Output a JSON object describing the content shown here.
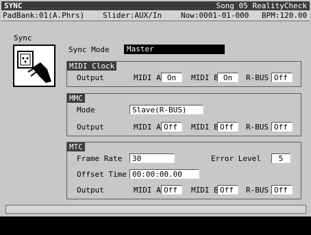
{
  "title": "SYNC",
  "song": "Song 05 RealityCheck",
  "info": {
    "padbank": "PadBank:01(A.Phrs)",
    "slider": "Slider:AUX/In",
    "now": "Now:0001-01-000",
    "bpm": "BPM:120.00"
  },
  "sidebar_label": "Sync",
  "sync_mode": {
    "label": "Sync Mode",
    "value": "Master"
  },
  "midi_clock": {
    "title": "MIDI Clock",
    "output_label": "Output",
    "midi_a_label": "MIDI A",
    "midi_a": "On",
    "midi_b_label": "MIDI B",
    "midi_b": "On",
    "rbus_label": "R-BUS",
    "rbus": "Off"
  },
  "mmc": {
    "title": "MMC",
    "mode_label": "Mode",
    "mode_value": "Slave(R-BUS)",
    "output_label": "Output",
    "midi_a_label": "MIDI A",
    "midi_a": "Off",
    "midi_b_label": "MIDI B",
    "midi_b": "Off",
    "rbus_label": "R-BUS",
    "rbus": "Off"
  },
  "mtc": {
    "title": "MTC",
    "frame_rate_label": "Frame Rate",
    "frame_rate": "30",
    "error_level_label": "Error Level",
    "error_level": "5",
    "offset_label": "Offset Time",
    "offset_value": "00:00:00.00",
    "output_label": "Output",
    "midi_a_label": "MIDI A",
    "midi_a": "Off",
    "midi_b_label": "MIDI B",
    "midi_b": "Off",
    "rbus_label": "R-BUS",
    "rbus": "Off"
  }
}
